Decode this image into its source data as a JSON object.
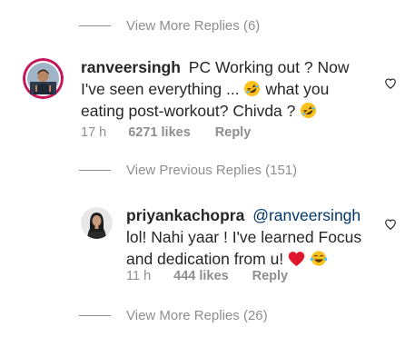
{
  "thread_top": {
    "more_replies_label": "View More Replies (6)"
  },
  "comment_1": {
    "username": "ranveersingh",
    "text_part1": "PC Working out ? Now I've seen everything ...",
    "text_part2": "what you eating post-workout? Chivda ?",
    "time": "17 h",
    "likes": "6271 likes",
    "reply_label": "Reply",
    "emoji": "rolling-on-floor-laughing-icon"
  },
  "previous_replies": {
    "label": "View Previous Replies (151)"
  },
  "comment_2": {
    "username": "priyankachopra",
    "mention": "@ranveersingh",
    "text": "lol! Nahi yaar ! I've learned Focus and dedication from u!",
    "time": "11 h",
    "likes": "444 likes",
    "reply_label": "Reply",
    "emojis": [
      "red-heart-icon",
      "tears-of-joy-icon"
    ]
  },
  "thread_bottom": {
    "more_replies_label": "View More Replies (26)"
  },
  "colors": {
    "text": "#262626",
    "secondary": "#8e8e8e",
    "mention": "#00376b",
    "heart": "#ed4956"
  }
}
